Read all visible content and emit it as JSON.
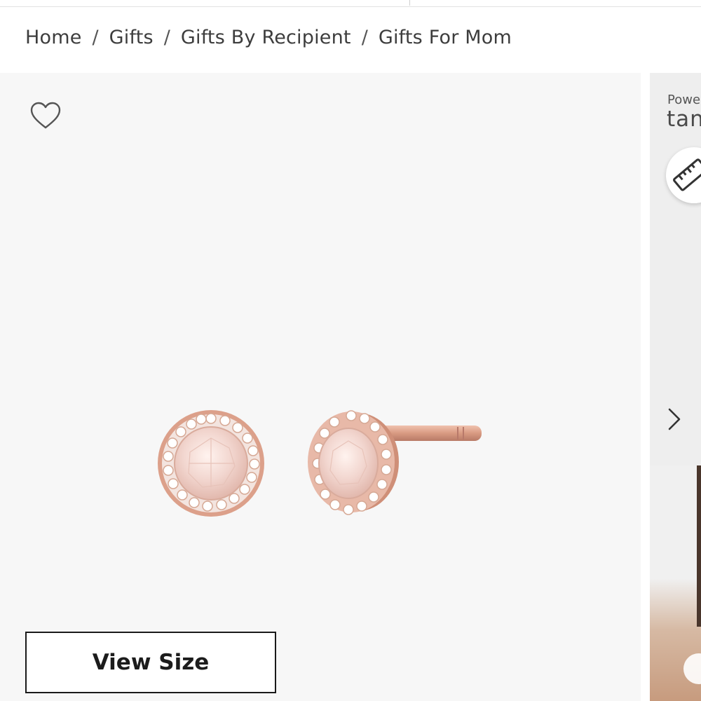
{
  "breadcrumb": {
    "items": [
      "Home",
      "Gifts",
      "Gifts By Recipient",
      "Gifts For Mom"
    ],
    "separator": "/"
  },
  "gallery": {
    "wishlist_icon": "heart-outline-icon",
    "view_size_label": "View Size"
  },
  "side_panel": {
    "powered_label": "Powe",
    "brand_label": "tan",
    "ruler_icon": "ruler-icon",
    "next_icon": "chevron-right-icon"
  },
  "colors": {
    "gallery_bg": "#f7f7f7",
    "rose_gold": "#d8a08a",
    "stone": "#f4dcd6"
  }
}
